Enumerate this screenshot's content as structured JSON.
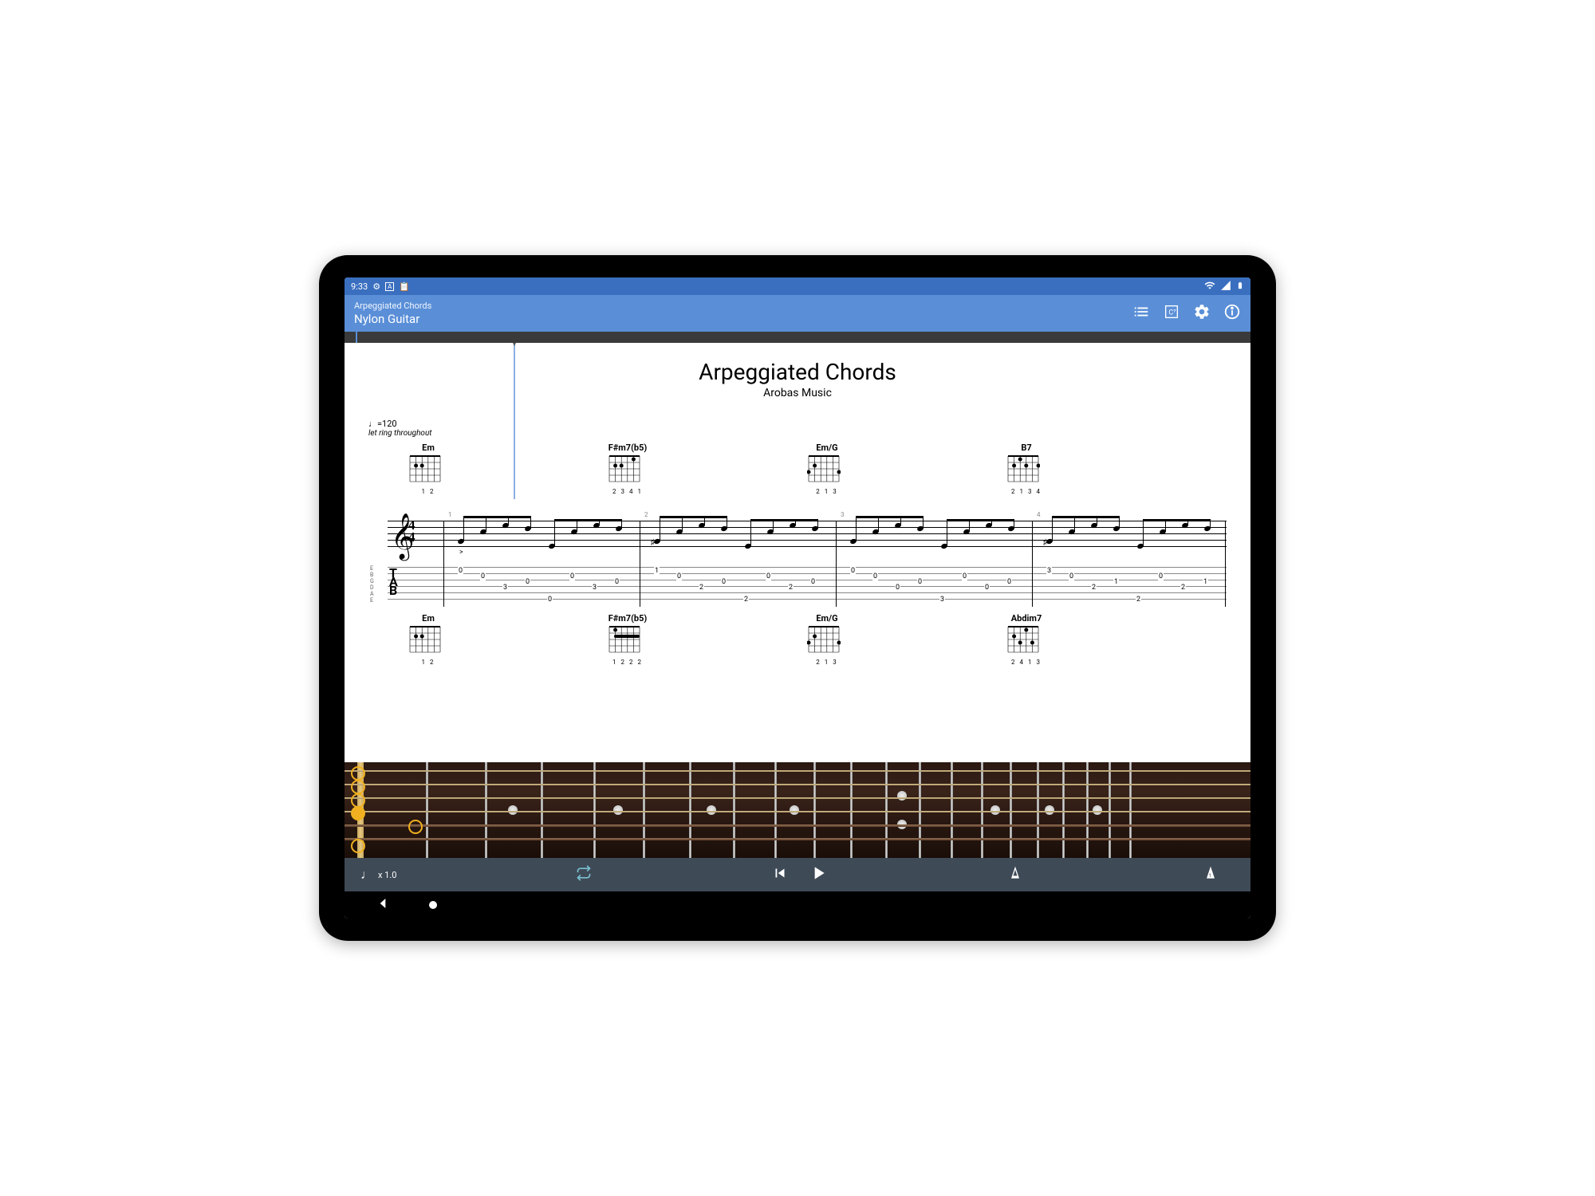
{
  "status": {
    "time": "9:33",
    "icons_left": [
      "gear-icon",
      "text-icon",
      "clipboard-icon"
    ],
    "icons_right": [
      "wifi-icon",
      "signal-icon",
      "battery-icon"
    ]
  },
  "header": {
    "song_title": "Arpeggiated Chords",
    "track_name": "Nylon Guitar",
    "actions": [
      "tracklist-icon",
      "chord-library-icon",
      "settings-icon",
      "info-icon"
    ]
  },
  "score": {
    "title": "Arpeggiated Chords",
    "composer": "Arobas Music",
    "tempo": "♩=120",
    "instruction": "let ring throughout",
    "time_signature": {
      "top": "4",
      "bot": "4"
    },
    "string_tuning": [
      "E",
      "B",
      "G",
      "D",
      "A",
      "E"
    ],
    "tab_label": "T\nA\nB",
    "chord_row_1": [
      {
        "name": "Em",
        "fingers": "1 2"
      },
      {
        "name": "F#m7(b5)",
        "fingers": "2  3 4 1"
      },
      {
        "name": "Em/G",
        "fingers": "2   1     3"
      },
      {
        "name": "B7",
        "fingers": "2 1 3   4"
      }
    ],
    "chord_row_2": [
      {
        "name": "Em",
        "fingers": "1 2"
      },
      {
        "name": "F#m7(b5)",
        "fingers": "1 2 2 2"
      },
      {
        "name": "Em/G",
        "fingers": "2   1     3"
      },
      {
        "name": "Abdim7",
        "fingers": "2 4 1 3"
      }
    ],
    "measures": [
      {
        "num": "1",
        "tab": [
          [
            "0",
            "78"
          ],
          [
            "0",
            "85"
          ],
          [
            "3",
            "99"
          ],
          [
            "0",
            "92"
          ],
          [
            "0",
            "114"
          ],
          [
            "0",
            "85"
          ],
          [
            "3",
            "99"
          ],
          [
            "0",
            "92"
          ]
        ],
        "accent": ">"
      },
      {
        "num": "2",
        "tab": [
          [
            "1",
            "78"
          ],
          [
            "0",
            "85"
          ],
          [
            "2",
            "99"
          ],
          [
            "0",
            "92"
          ],
          [
            "2",
            "114"
          ],
          [
            "0",
            "85"
          ],
          [
            "2",
            "99"
          ],
          [
            "0",
            "92"
          ]
        ]
      },
      {
        "num": "3",
        "tab": [
          [
            "0",
            "78"
          ],
          [
            "0",
            "85"
          ],
          [
            "0",
            "99"
          ],
          [
            "0",
            "92"
          ],
          [
            "3",
            "114"
          ],
          [
            "0",
            "85"
          ],
          [
            "0",
            "99"
          ],
          [
            "0",
            "92"
          ]
        ]
      },
      {
        "num": "4",
        "tab": [
          [
            "3",
            "78"
          ],
          [
            "0",
            "85"
          ],
          [
            "2",
            "99"
          ],
          [
            "1",
            "92"
          ],
          [
            "2",
            "114"
          ],
          [
            "0",
            "85"
          ],
          [
            "2",
            "99"
          ],
          [
            "1",
            "92"
          ]
        ]
      }
    ]
  },
  "playback": {
    "speed": "x 1.0",
    "icons": [
      "tempo-icon",
      "loop-icon",
      "prev-icon",
      "play-icon",
      "metronome-icon",
      "countdown-icon"
    ]
  },
  "colors": {
    "primary": "#5a8fd8",
    "status": "#3a6fc0",
    "playbar": "#3e4a56"
  }
}
